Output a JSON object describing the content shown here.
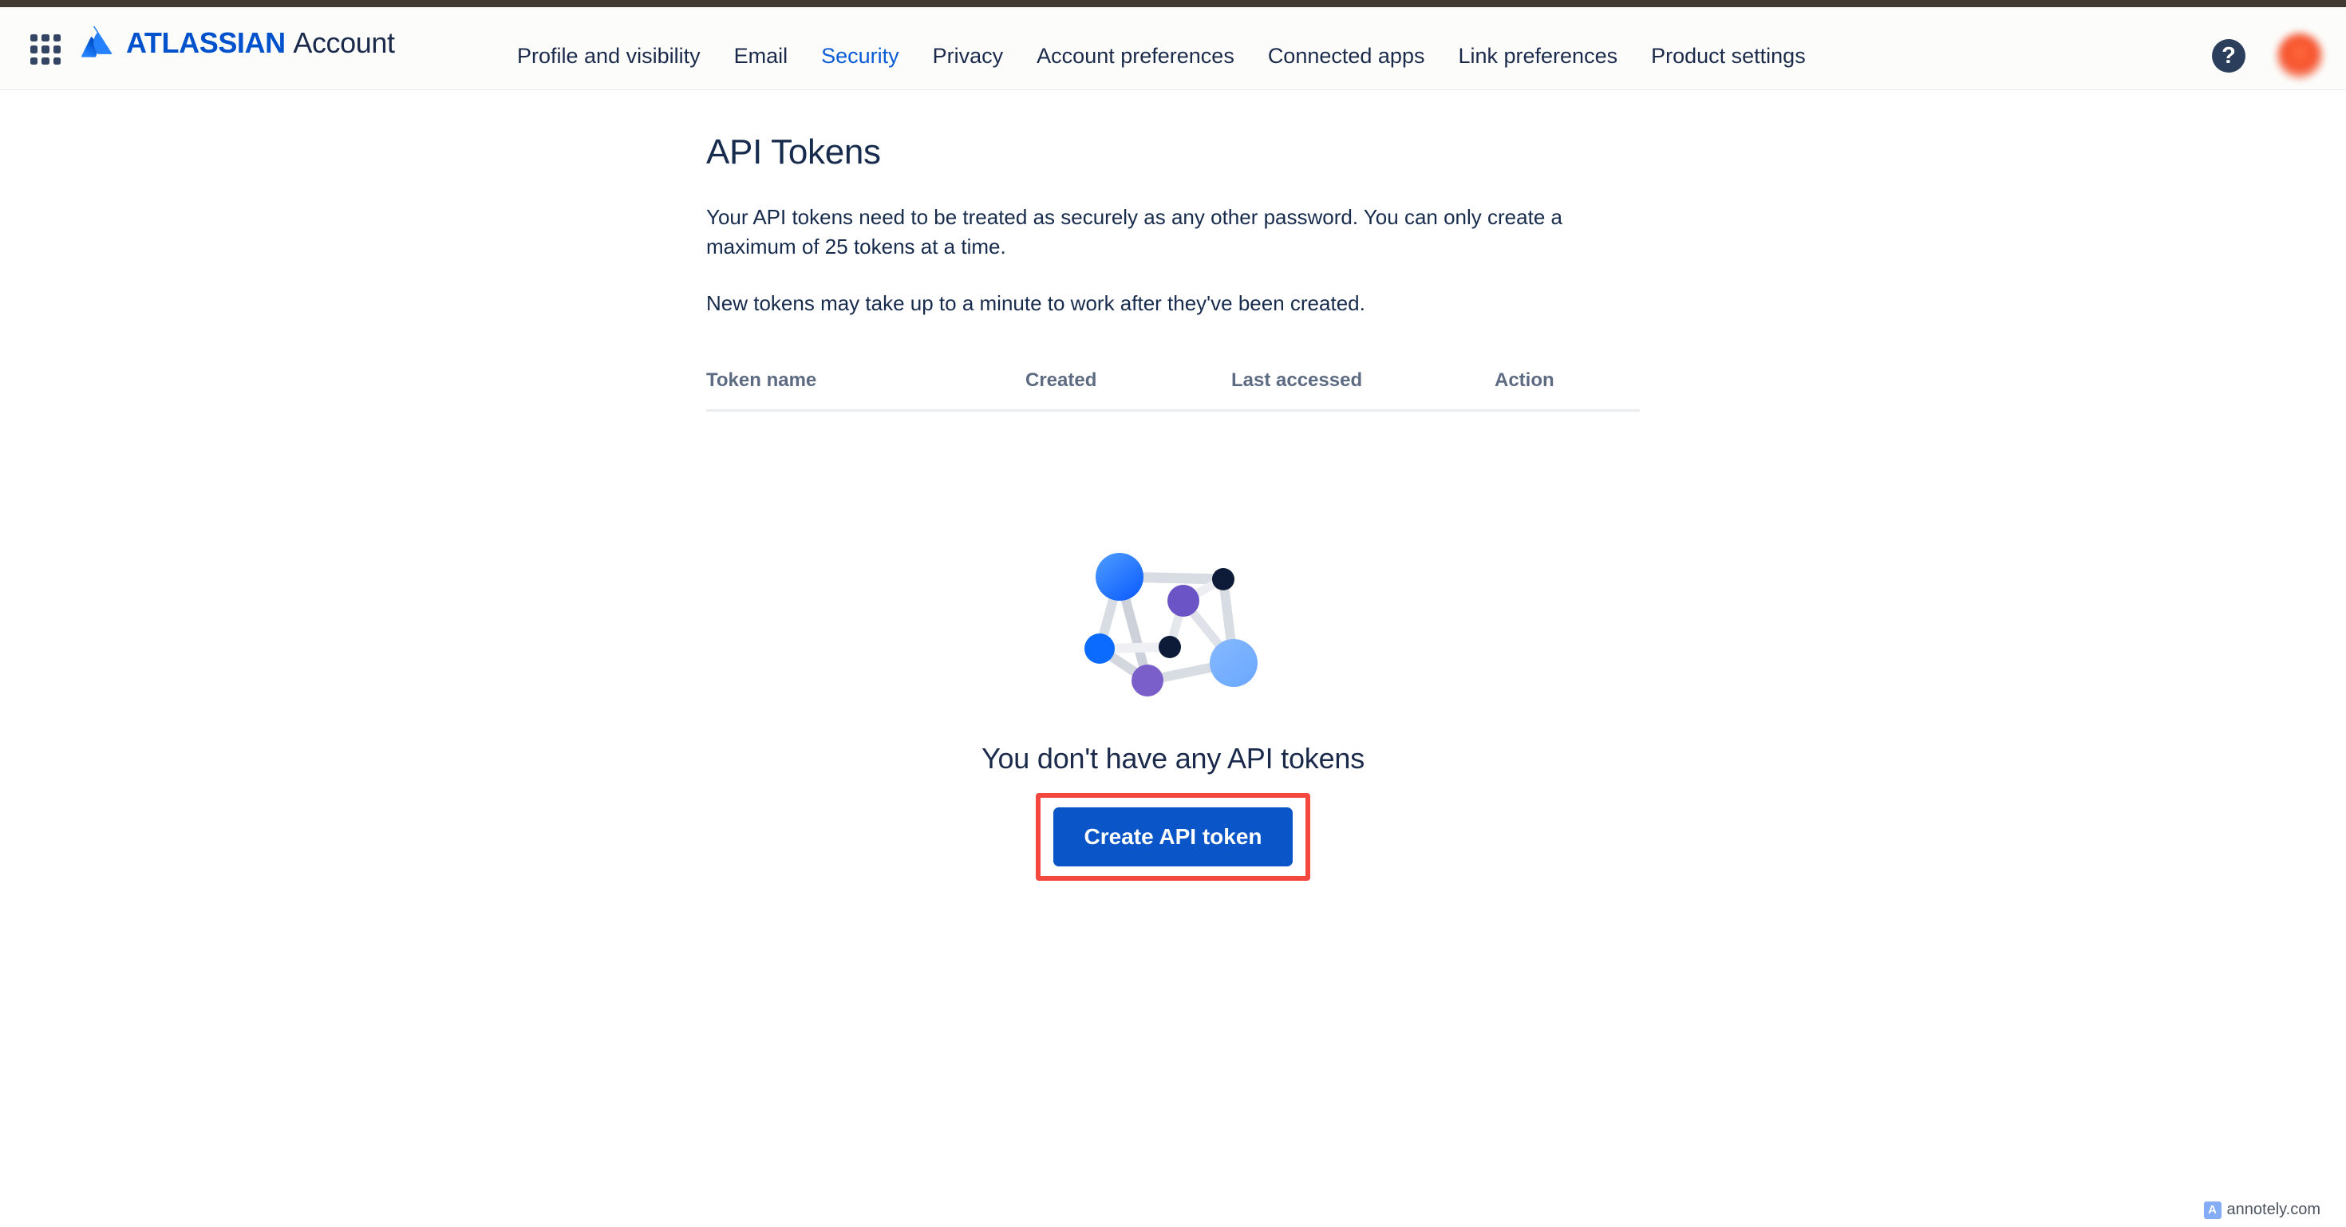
{
  "header": {
    "app_switcher_icon": "grid-apps-icon",
    "brand_logo_icon": "atlassian-logo-icon",
    "brand_bold": "ATLASSIAN",
    "brand_regular": "Account",
    "help_icon": "help-question-icon",
    "help_glyph": "?",
    "avatar_icon": "user-avatar",
    "nav": [
      {
        "label": "Profile and visibility",
        "active": false
      },
      {
        "label": "Email",
        "active": false
      },
      {
        "label": "Security",
        "active": true
      },
      {
        "label": "Privacy",
        "active": false
      },
      {
        "label": "Account preferences",
        "active": false
      },
      {
        "label": "Connected apps",
        "active": false
      },
      {
        "label": "Link preferences",
        "active": false
      },
      {
        "label": "Product settings",
        "active": false
      }
    ]
  },
  "main": {
    "title": "API Tokens",
    "paragraph_1": "Your API tokens need to be treated as securely as any other password. You can only create a maximum of 25 tokens at a time.",
    "paragraph_2": "New tokens may take up to a minute to work after they've been created.",
    "table": {
      "columns": [
        "Token name",
        "Created",
        "Last accessed",
        "Action"
      ],
      "rows": []
    },
    "empty_state": {
      "illustration": "network-graph-illustration",
      "title": "You don't have any API tokens",
      "cta_label": "Create API token"
    }
  },
  "annotation": {
    "highlight_color": "#f4483f",
    "target": "Create API token"
  },
  "watermark": {
    "logo_glyph": "A",
    "logo_icon": "annotely-logo-icon",
    "text": "annotely.com"
  },
  "colors": {
    "brand_blue": "#0052cc",
    "nav_active": "#0c5bd6",
    "text_primary": "#172b4d",
    "text_muted": "#5d6b82",
    "cta_blue": "#0a56c8",
    "chrome_strip": "#413a33"
  }
}
